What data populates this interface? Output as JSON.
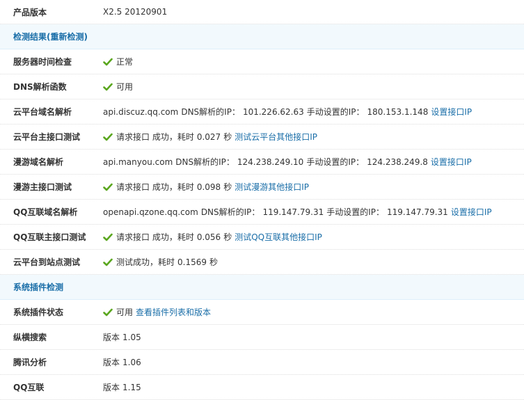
{
  "version": {
    "label": "产品版本",
    "value": "X2.5 20120901"
  },
  "check_section": {
    "title": "检测结果",
    "open_paren": "(",
    "recheck_link": "重新检测",
    "close_paren": ")"
  },
  "checks": {
    "server_time": {
      "label": "服务器时间检查",
      "status": "正常"
    },
    "dns_func": {
      "label": "DNS解析函数",
      "status": "可用"
    },
    "cloud_dns": {
      "label": "云平台域名解析",
      "host": "api.discuz.qq.com",
      "dns_label": "DNS解析的IP：",
      "dns_ip": "101.226.62.63",
      "manual_label": "手动设置的IP：",
      "manual_ip": "180.153.1.148",
      "link": "设置接口IP"
    },
    "cloud_api": {
      "label": "云平台主接口测试",
      "req": "请求接口 成功，耗时",
      "time": "0.027",
      "unit": "秒",
      "link": "测试云平台其他接口IP"
    },
    "manyou_dns": {
      "label": "漫游域名解析",
      "host": "api.manyou.com",
      "dns_label": "DNS解析的IP：",
      "dns_ip": "124.238.249.10",
      "manual_label": "手动设置的IP：",
      "manual_ip": "124.238.249.8",
      "link": "设置接口IP"
    },
    "manyou_api": {
      "label": "漫游主接口测试",
      "req": "请求接口 成功，耗时",
      "time": "0.098",
      "unit": "秒",
      "link": "测试漫游其他接口IP"
    },
    "qq_dns": {
      "label": "QQ互联域名解析",
      "host": "openapi.qzone.qq.com",
      "dns_label": "DNS解析的IP：",
      "dns_ip": "119.147.79.31",
      "manual_label": "手动设置的IP：",
      "manual_ip": "119.147.79.31",
      "link": "设置接口IP"
    },
    "qq_api": {
      "label": "QQ互联主接口测试",
      "req": "请求接口 成功，耗时",
      "time": "0.056",
      "unit": "秒",
      "link": "测试QQ互联其他接口IP"
    },
    "cloud_site": {
      "label": "云平台到站点测试",
      "req": "测试成功，耗时",
      "time": "0.1569",
      "unit": "秒"
    }
  },
  "plugin_section": {
    "title": "系统插件检测"
  },
  "plugins": {
    "status": {
      "label": "系统插件状态",
      "status": "可用",
      "link": "查看插件列表和版本"
    },
    "search": {
      "label": "纵横搜索",
      "version_label": "版本",
      "version": "1.05"
    },
    "tencent": {
      "label": "腾讯分析",
      "version_label": "版本",
      "version": "1.06"
    },
    "qqconnect": {
      "label": "QQ互联",
      "version_label": "版本",
      "version": "1.15"
    }
  },
  "colors": {
    "link": "#1a6ea8",
    "section_bg": "#f2f9fd",
    "ok_green": "#5aa61e"
  },
  "icons": {
    "ok": "green-check-icon"
  }
}
